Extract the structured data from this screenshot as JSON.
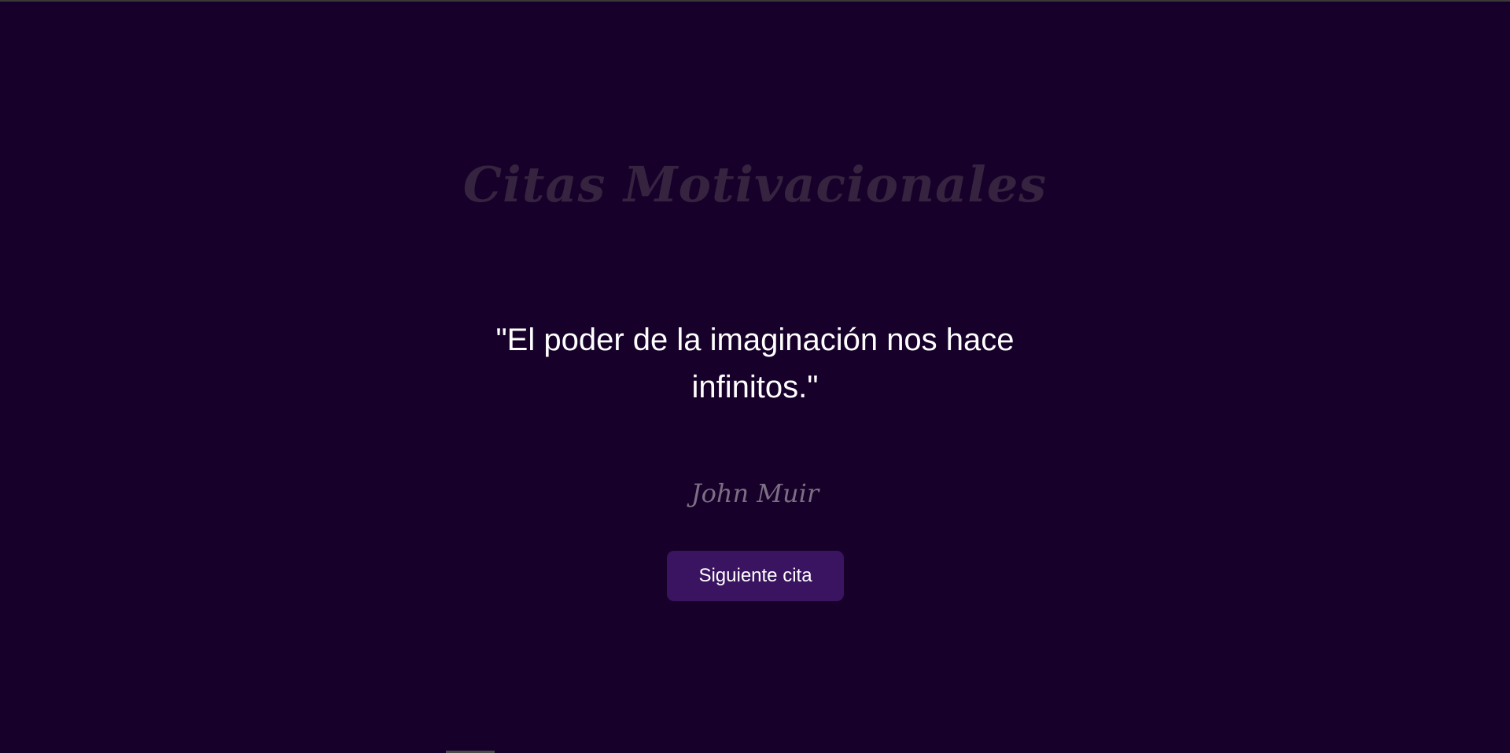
{
  "header": {
    "title": "Citas Motivacionales"
  },
  "quote": {
    "text": "\"El poder de la imaginación nos hace infinitos.\"",
    "author": "John Muir"
  },
  "actions": {
    "next_label": "Siguiente cita"
  },
  "colors": {
    "background": "#17012a",
    "title": "#35233f",
    "quote_text": "#ffffff",
    "author": "#7c6e83",
    "button_bg": "#3b1461"
  }
}
